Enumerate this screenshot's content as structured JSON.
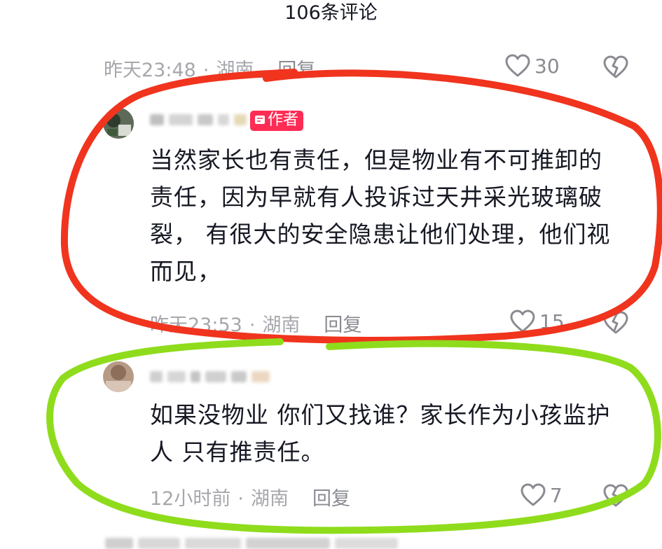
{
  "header": {
    "title": "106条评论"
  },
  "comments": [
    {
      "time": "昨天23:48",
      "location": "湖南",
      "reply_label": "回复",
      "likes": "30"
    },
    {
      "author_badge": "作者",
      "text": "当然家长也有责任，但是物业有不可推卸的责任，因为早就有人投诉过天井采光玻璃破裂， 有很大的安全隐患让他们处理，他们视而见，",
      "text_lines": [
        "当然家长也有责任，但是物业有不可推卸的",
        "责任，因为早就有人投诉过天井采光玻璃破",
        "裂， 有很大的安全隐患让他们处理，他们视",
        "而见，"
      ],
      "time": "昨天23:53",
      "location": "湖南",
      "reply_label": "回复",
      "likes": "15"
    },
    {
      "text_lines": [
        "如果没物业 你们又找谁？家长作为小孩监护",
        "人 只有推责任。"
      ],
      "time": "12小时前",
      "location": "湖南",
      "reply_label": "回复",
      "likes": "7"
    }
  ],
  "separator": "·",
  "colors": {
    "author_badge": "#fe2c55",
    "red_annotation": "#f0341e",
    "green_annotation": "#8fdc1c",
    "meta_text": "#a6a7ac"
  },
  "icons": [
    "heart-icon",
    "broken-heart-icon",
    "pen-icon"
  ]
}
